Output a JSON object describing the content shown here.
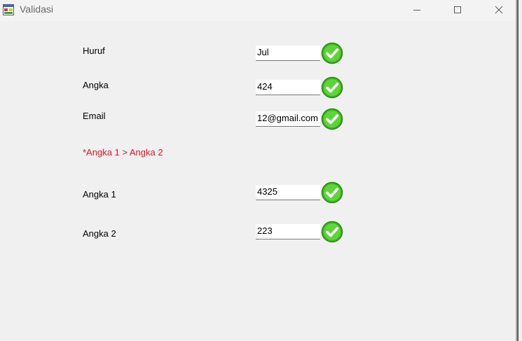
{
  "window": {
    "title": "Validasi"
  },
  "form": {
    "huruf": {
      "label": "Huruf",
      "value": "Jul"
    },
    "angka": {
      "label": "Angka",
      "value": "424"
    },
    "email": {
      "label": "Email",
      "value": "12@gmail.com"
    },
    "warning": "*Angka 1 > Angka 2",
    "angka1": {
      "label": "Angka 1",
      "value": "4325"
    },
    "angka2": {
      "label": "Angka 2",
      "value": "223"
    }
  },
  "icons": {
    "app": "form-app-icon",
    "valid": "green-check-icon",
    "minimize": "minimize-icon",
    "maximize": "maximize-icon",
    "close": "close-icon"
  },
  "colors": {
    "warning": "#e81123",
    "check": "#3cb81c",
    "background": "#f0f0f0"
  }
}
